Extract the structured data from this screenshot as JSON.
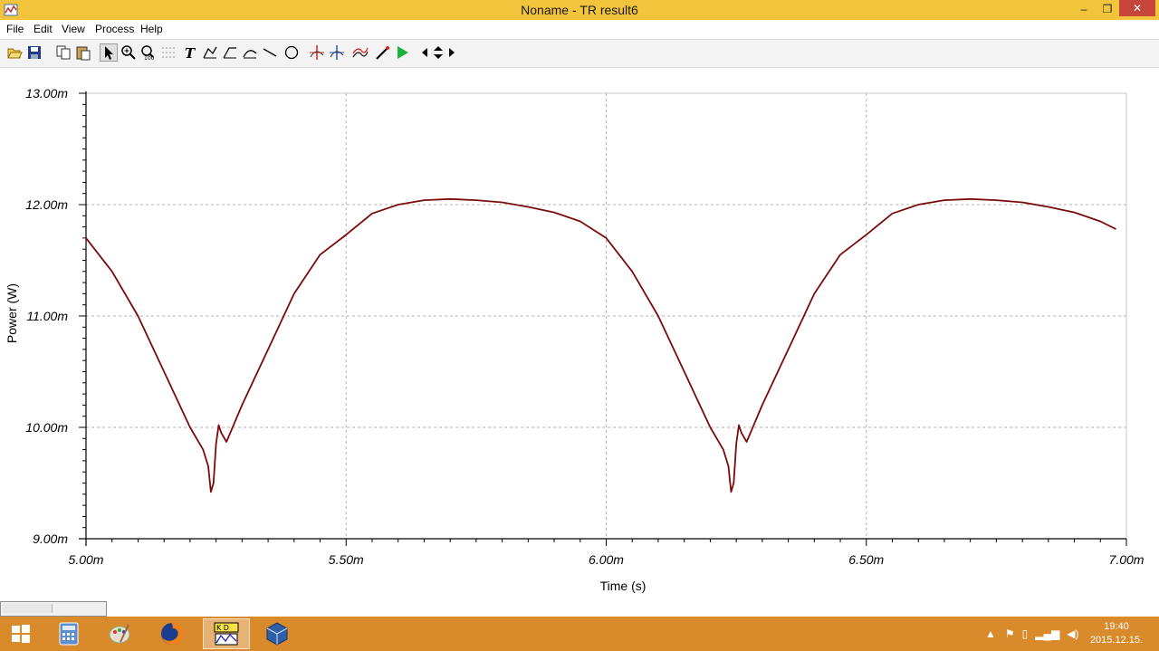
{
  "window": {
    "title": "Noname - TR result6",
    "min_glyph": "–",
    "max_glyph": "❐",
    "close_glyph": "✕"
  },
  "menu": [
    "File",
    "Edit",
    "View",
    "Process",
    "Help"
  ],
  "toolbar": {
    "icons": [
      "open-icon",
      "save-icon",
      "copy-icon",
      "paste-icon",
      "pointer-icon",
      "zoom-in-icon",
      "zoom-100-icon",
      "grid-icon",
      "text-icon",
      "curve-tool-icon",
      "curve-tool-2-icon",
      "curve-tool-3-icon",
      "line-icon",
      "circle-icon",
      "cursor-a-icon",
      "cursor-b-icon",
      "add-trace-icon",
      "marker-icon",
      "run-icon",
      "scroll-left-icon",
      "scroll-vertical-icon",
      "scroll-right-icon"
    ]
  },
  "chart_data": {
    "type": "line",
    "xlabel": "Time (s)",
    "ylabel": "Power (W)",
    "xlim": [
      5.0,
      7.0
    ],
    "ylim": [
      9.0,
      13.0
    ],
    "x_ticks": [
      "5.00m",
      "5.50m",
      "6.00m",
      "6.50m",
      "7.00m"
    ],
    "y_ticks": [
      "13.00m",
      "12.00m",
      "11.00m",
      "10.00m",
      "9.00m"
    ],
    "grid": true,
    "line_color": "#7a0b0b",
    "series": [
      {
        "x": [
          5.0,
          5.05,
          5.1,
          5.15,
          5.2,
          5.225,
          5.235,
          5.24,
          5.245,
          5.25,
          5.255,
          5.26,
          5.27,
          5.3,
          5.35,
          5.4,
          5.45,
          5.5,
          5.55,
          5.6,
          5.65,
          5.7,
          5.75,
          5.8,
          5.85,
          5.9,
          5.95,
          6.0,
          6.05,
          6.1,
          6.15,
          6.2,
          6.225,
          6.235,
          6.24,
          6.245,
          6.25,
          6.255,
          6.26,
          6.27,
          6.3,
          6.35,
          6.4,
          6.45,
          6.5,
          6.55,
          6.6,
          6.65,
          6.7,
          6.75,
          6.8,
          6.85,
          6.9,
          6.95,
          6.98
        ],
        "y": [
          11.7,
          11.4,
          11.0,
          10.5,
          10.0,
          9.8,
          9.65,
          9.42,
          9.5,
          9.85,
          10.02,
          9.95,
          9.87,
          10.2,
          10.7,
          11.2,
          11.55,
          11.73,
          11.92,
          12.0,
          12.04,
          12.05,
          12.04,
          12.02,
          11.98,
          11.93,
          11.85,
          11.7,
          11.4,
          11.0,
          10.5,
          10.0,
          9.8,
          9.65,
          9.42,
          9.5,
          9.85,
          10.02,
          9.95,
          9.87,
          10.2,
          10.7,
          11.2,
          11.55,
          11.73,
          11.92,
          12.0,
          12.04,
          12.05,
          12.04,
          12.02,
          11.98,
          11.93,
          11.85,
          11.78
        ]
      }
    ]
  },
  "taskbar": {
    "apps": [
      "start-icon",
      "calculator-icon",
      "paint-icon",
      "firefox-icon",
      "tina-icon",
      "virtualbox-icon"
    ],
    "clock_time": "19:40",
    "clock_date": "2015.12.15."
  }
}
